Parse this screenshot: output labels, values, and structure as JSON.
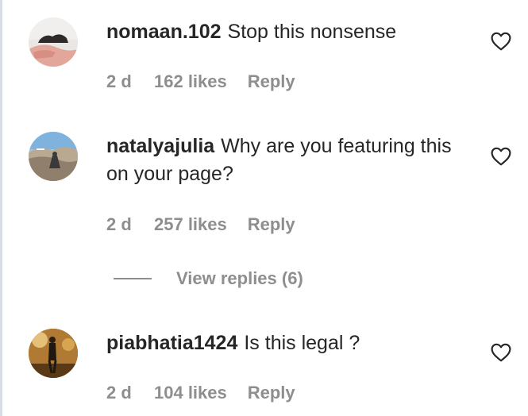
{
  "comments": [
    {
      "username": "nomaan.102",
      "text": "Stop this nonsense",
      "time": "2 d",
      "likes": "162 likes",
      "reply_label": "Reply"
    },
    {
      "username": "natalyajulia",
      "text": "Why are you featuring this on your page?",
      "time": "2 d",
      "likes": "257 likes",
      "reply_label": "Reply"
    },
    {
      "username": "piabhatia1424",
      "text": "Is this legal ?",
      "time": "2 d",
      "likes": "104 likes",
      "reply_label": "Reply"
    }
  ],
  "view_replies": {
    "label": "View replies (6)"
  },
  "icons": {
    "like": "heart-outline-icon"
  }
}
